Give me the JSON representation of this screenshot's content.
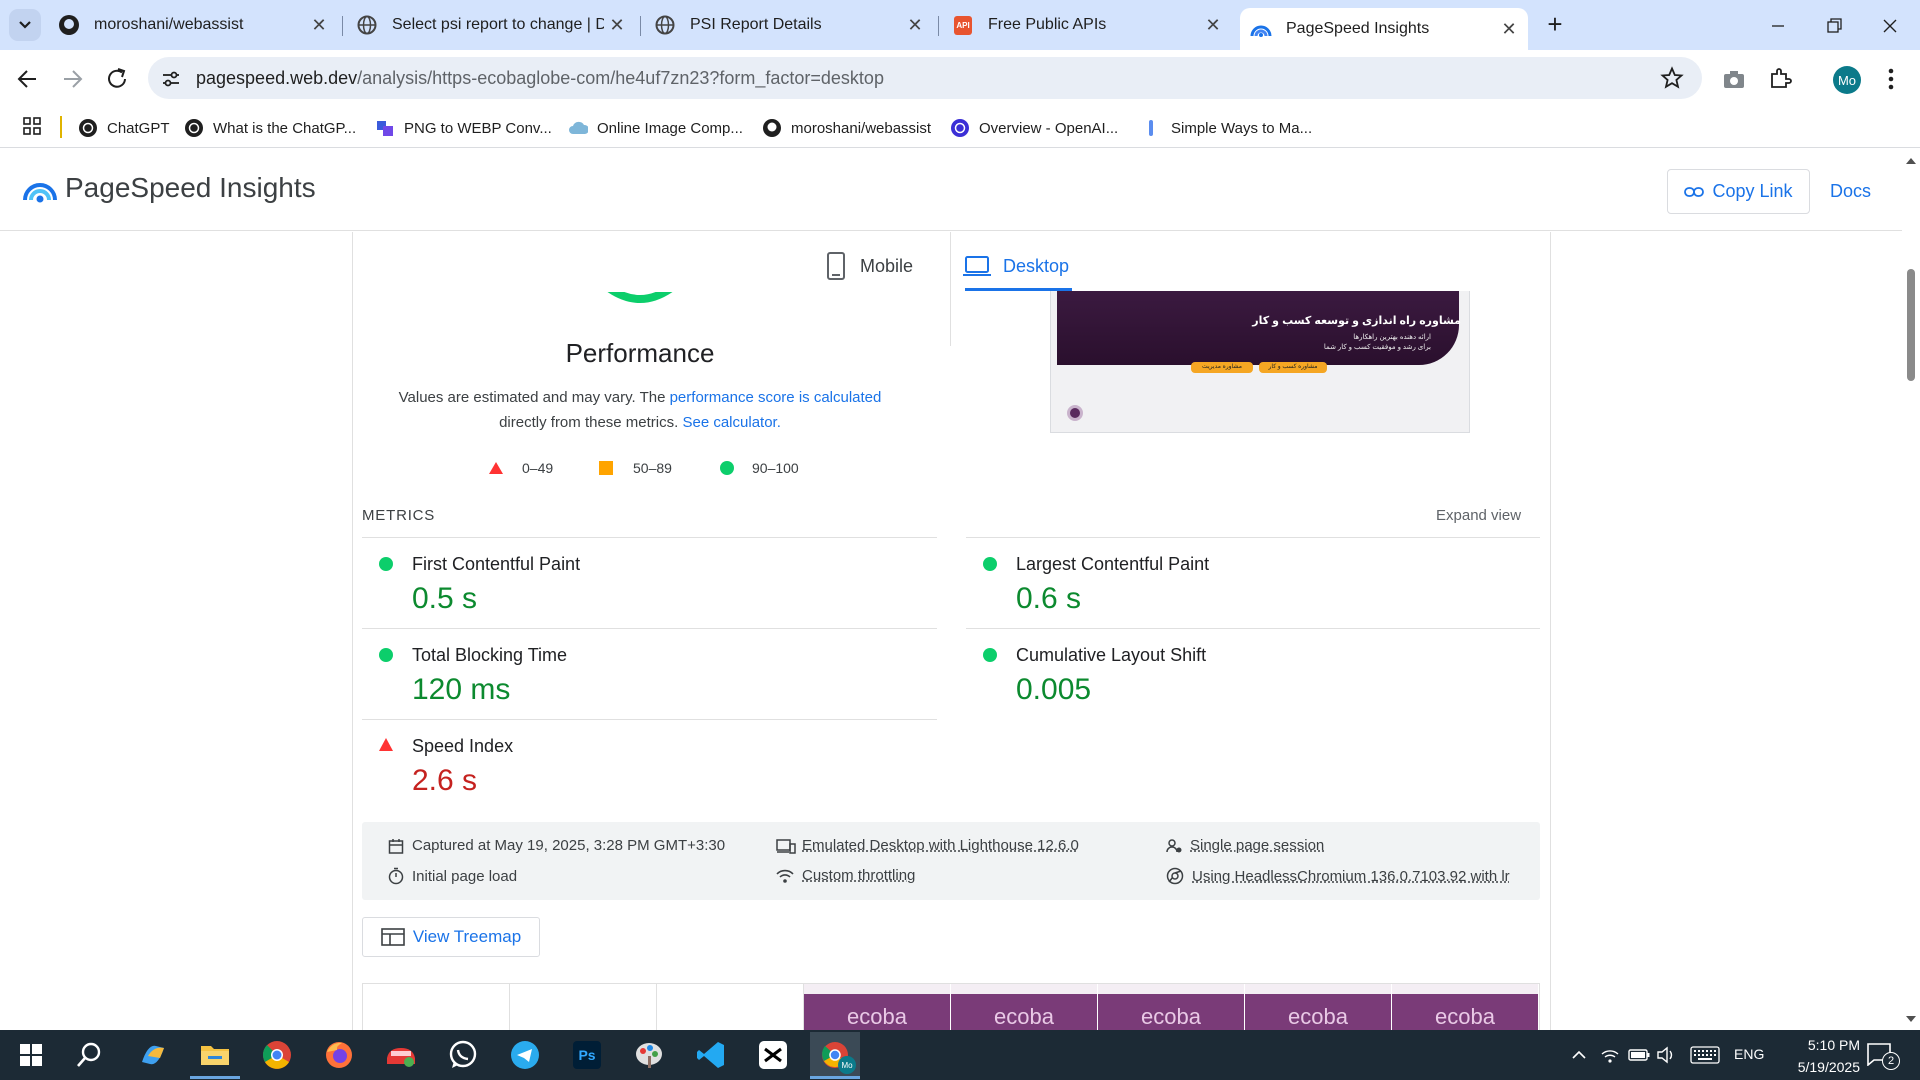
{
  "browser": {
    "tabs": [
      {
        "title": "moroshani/webassist",
        "icon": "github-icon"
      },
      {
        "title": "Select psi report to change | Dj",
        "icon": "globe-icon"
      },
      {
        "title": "PSI Report Details",
        "icon": "globe-icon"
      },
      {
        "title": "Free Public APIs",
        "icon": "api-icon"
      },
      {
        "title": "PageSpeed Insights",
        "icon": "pagespeed-icon"
      }
    ],
    "url_host": "pagespeed.web.dev",
    "url_path": "/analysis/https-ecobaglobe-com/he4uf7zn23?form_factor=desktop",
    "profile_initials": "Mo",
    "api_badge": "API",
    "bookmarks": [
      "ChatGPT",
      "What is the ChatGP...",
      "PNG to WEBP Conv...",
      "Online Image Comp...",
      "moroshani/webassist",
      "Overview - OpenAI...",
      "Simple Ways to Ma..."
    ]
  },
  "app": {
    "title": "PageSpeed Insights",
    "copy_link": "Copy Link",
    "docs": "Docs",
    "tabs": {
      "mobile": "Mobile",
      "desktop": "Desktop"
    }
  },
  "performance": {
    "title": "Performance",
    "desc_prefix": "Values are estimated and may vary. The ",
    "desc_link1": "performance score is calculated",
    "desc_mid": "directly from these metrics.",
    "desc_link2": "See calculator.",
    "legend": [
      "0–49",
      "50–89",
      "90–100"
    ]
  },
  "screenshot_preview": {
    "headline": "مشاوره راه اندازی و توسعه کسب و کار",
    "sub1": "ارائه دهنده بهترین راهکارها",
    "sub2": "برای رشد و موفقیت کسب و کار شما",
    "btn1": "مشاوره کسب و کار",
    "btn2": "مشاوره مدیریت"
  },
  "metrics": {
    "header": "METRICS",
    "expand": "Expand view",
    "items": [
      {
        "name": "First Contentful Paint",
        "value": "0.5 s",
        "status": "good"
      },
      {
        "name": "Largest Contentful Paint",
        "value": "0.6 s",
        "status": "good"
      },
      {
        "name": "Total Blocking Time",
        "value": "120 ms",
        "status": "good"
      },
      {
        "name": "Cumulative Layout Shift",
        "value": "0.005",
        "status": "good"
      },
      {
        "name": "Speed Index",
        "value": "2.6 s",
        "status": "poor"
      }
    ]
  },
  "runinfo": {
    "captured": "Captured at May 19, 2025, 3:28 PM GMT+3:30",
    "initial": "Initial page load",
    "emulated": "Emulated Desktop with Lighthouse 12.6.0",
    "throttling": "Custom throttling",
    "session": "Single page session",
    "browser": "Using HeadlessChromium 136.0.7103.92 with lr"
  },
  "treemap": "View Treemap",
  "filmstrip_text": "ecoba",
  "taskbar": {
    "lang": "ENG",
    "time": "5:10 PM",
    "date": "5/19/2025",
    "notif": "2"
  },
  "colors": {
    "good": "#0cce6b",
    "average": "#ffa400",
    "poor": "#ff3333",
    "accent": "#1a73e8"
  }
}
